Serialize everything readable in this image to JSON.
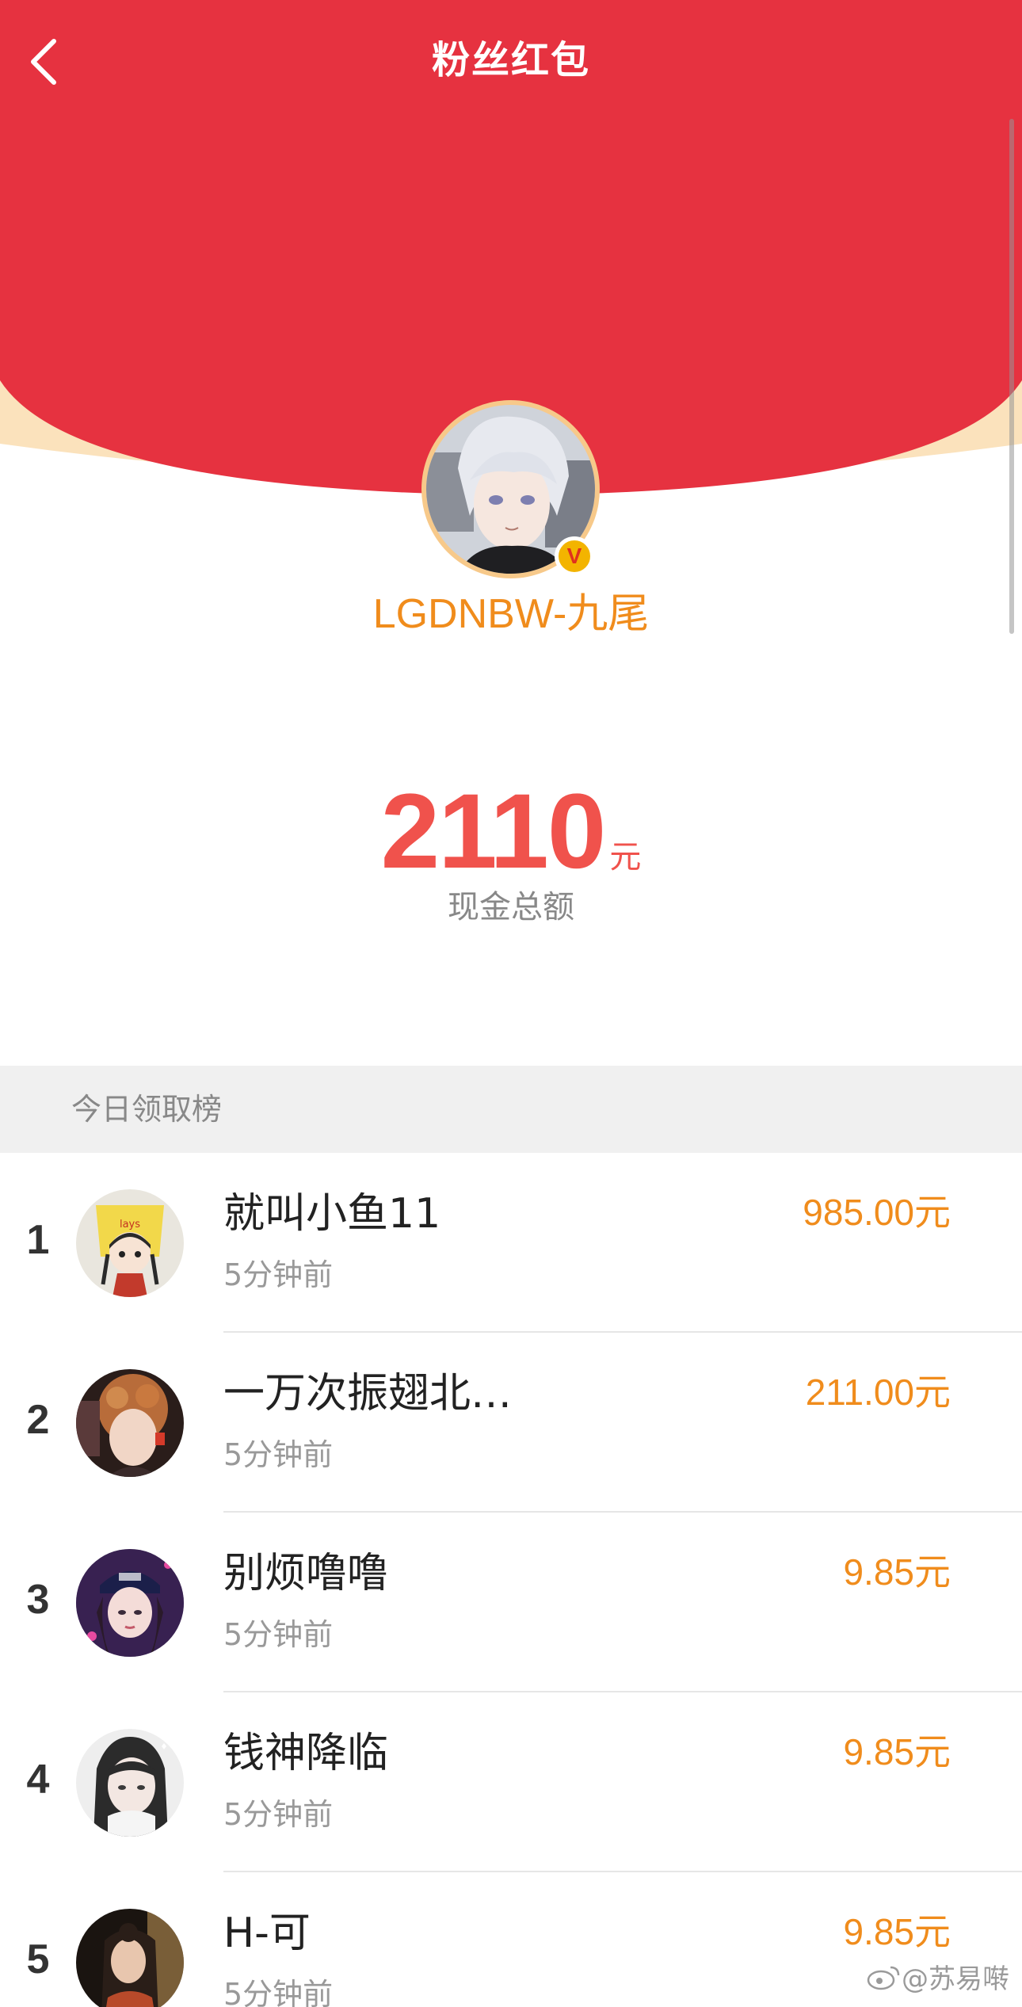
{
  "header": {
    "title": "粉丝红包",
    "back_icon": "chevron-left-icon"
  },
  "profile": {
    "username": "LGDNBW-九尾",
    "verified_badge": "V"
  },
  "summary": {
    "amount": "2110",
    "unit": "元",
    "label": "现金总额"
  },
  "leaderboard": {
    "title": "今日领取榜",
    "items": [
      {
        "rank": "1",
        "name": "就叫小鱼11",
        "time": "5分钟前",
        "amount": "985.00元"
      },
      {
        "rank": "2",
        "name": "一万次振翅北…",
        "time": "5分钟前",
        "amount": "211.00元"
      },
      {
        "rank": "3",
        "name": "别烦噜噜",
        "time": "5分钟前",
        "amount": "9.85元"
      },
      {
        "rank": "4",
        "name": "钱神降临",
        "time": "5分钟前",
        "amount": "9.85元"
      },
      {
        "rank": "5",
        "name": "H-可",
        "time": "5分钟前",
        "amount": "9.85元"
      }
    ]
  },
  "watermark": {
    "text": "@苏易啭"
  },
  "colors": {
    "header_red": "#e63240",
    "header_rim": "#fbe2bc",
    "amount_red": "#f0524c",
    "accent_orange": "#f08c1c"
  }
}
